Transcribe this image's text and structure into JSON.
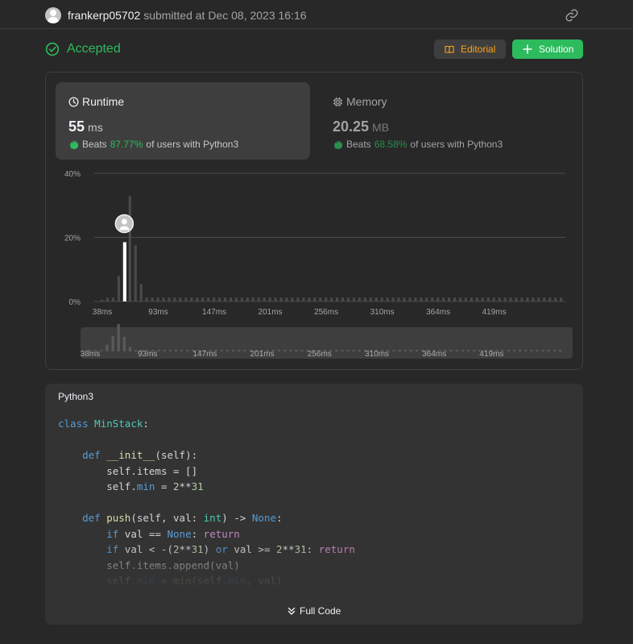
{
  "header": {
    "username": "frankerp05702",
    "submitted_text": "submitted at Dec 08, 2023 16:16"
  },
  "result": {
    "status": "Accepted",
    "editorial_label": "Editorial",
    "solution_label": "Solution"
  },
  "runtime": {
    "title": "Runtime",
    "value": "55",
    "unit": "ms",
    "beats_prefix": "Beats",
    "beats_pct": "87.77%",
    "beats_suffix": "of users with Python3"
  },
  "memory": {
    "title": "Memory",
    "value": "20.25",
    "unit": "MB",
    "beats_prefix": "Beats",
    "beats_pct": "68.58%",
    "beats_suffix": "of users with Python3"
  },
  "chart_data": {
    "type": "bar",
    "y_tick_labels": [
      "40%",
      "20%",
      "0%"
    ],
    "ylim": [
      0,
      40
    ],
    "x_tick_labels": [
      "38ms",
      "93ms",
      "147ms",
      "201ms",
      "256ms",
      "310ms",
      "364ms",
      "419ms"
    ],
    "grid": true,
    "highlight_index": 4,
    "values": [
      0.5,
      1.2,
      1.2,
      8,
      18.5,
      33,
      17.5,
      5.5,
      1.2,
      1.2,
      1.2,
      1.2,
      1.2,
      1.2,
      1.2,
      1.2,
      1.2,
      1.2,
      1.2,
      1.2,
      1.2,
      1.2,
      1.2,
      1.2,
      1.2,
      1.2,
      1.2,
      1.2,
      1.2,
      1.2,
      1.2,
      1.2,
      1.2,
      1.2,
      1.2,
      1.2,
      1.2,
      1.2,
      1.2,
      1.2,
      1.2,
      1.2,
      1.2,
      1.2,
      1.2,
      1.2,
      1.2,
      1.2,
      1.2,
      1.2,
      1.2,
      1.2,
      1.2,
      1.2,
      1.2,
      1.2,
      1.2,
      1.2,
      1.2,
      1.2,
      1.2,
      1.2,
      1.2,
      1.2,
      1.2,
      1.2,
      1.2,
      1.2,
      1.2,
      1.2,
      1.2,
      1.2,
      1.2,
      1.2,
      1.2,
      1.2,
      1.2,
      1.2,
      1.2,
      1.2,
      1.2,
      1.2,
      1.2
    ],
    "colors": {
      "bar": "#4a4a4a",
      "highlight": "#ffffff",
      "grid": "#4a4a4a"
    }
  },
  "code": {
    "language": "Python3",
    "full_code_label": "Full Code"
  }
}
